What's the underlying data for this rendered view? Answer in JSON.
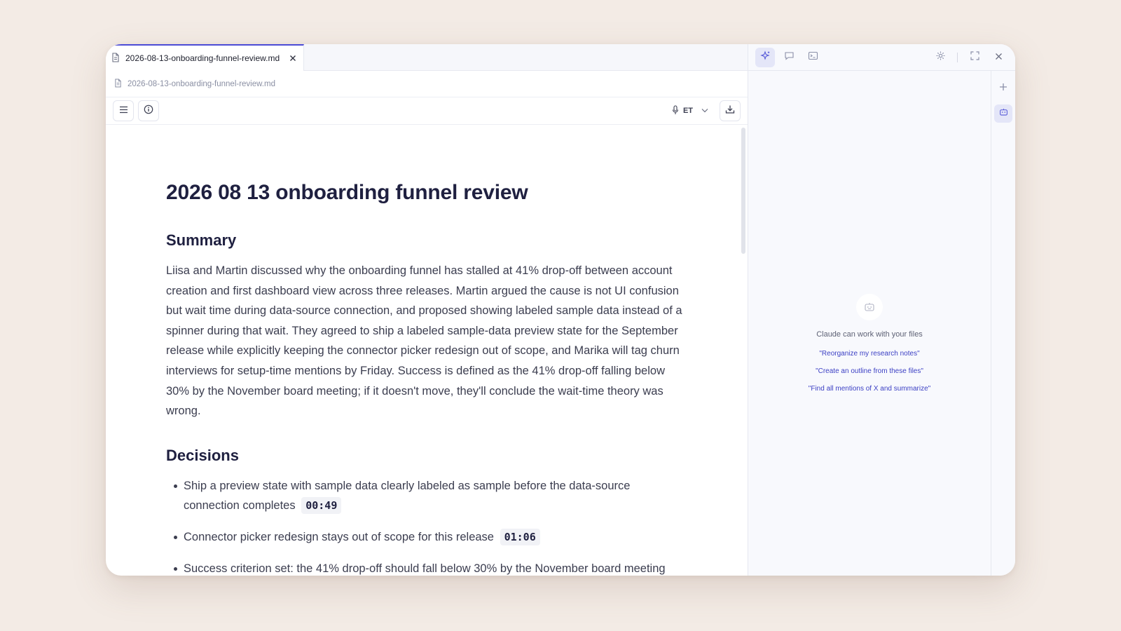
{
  "tab": {
    "label": "2026-08-13-onboarding-funnel-review.md"
  },
  "breadcrumb": {
    "label": "2026-08-13-onboarding-funnel-review.md"
  },
  "toolbar": {
    "language": "ET"
  },
  "document": {
    "title": "2026 08 13 onboarding funnel review",
    "summary_heading": "Summary",
    "summary": "Liisa and Martin discussed why the onboarding funnel has stalled at 41% drop-off between account creation and first dashboard view across three releases. Martin argued the cause is not UI confusion but wait time during data-source connection, and proposed showing labeled sample data instead of a spinner during that wait. They agreed to ship a labeled sample-data preview state for the September release while explicitly keeping the connector picker redesign out of scope, and Marika will tag churn interviews for setup-time mentions by Friday. Success is defined as the 41% drop-off falling below 30% by the November board meeting; if it doesn't move, they'll conclude the wait-time theory was wrong.",
    "decisions_heading": "Decisions",
    "decisions": [
      {
        "text": "Ship a preview state with sample data clearly labeled as sample before the data-source connection completes",
        "timestamp": "00:49"
      },
      {
        "text": "Connector picker redesign stays out of scope for this release",
        "timestamp": "01:06"
      },
      {
        "text": "Success criterion set: the 41% drop-off should fall below 30% by the November board meeting",
        "timestamp": ""
      }
    ]
  },
  "assistant": {
    "empty_title": "Claude can work with your files",
    "suggestions": [
      "\"Reorganize my research notes\"",
      "\"Create an outline from these files\"",
      "\"Find all mentions of X and summarize\""
    ]
  },
  "colors": {
    "accent": "#4b4bd6",
    "background": "#f3ebe5",
    "heading": "#1f2040"
  }
}
